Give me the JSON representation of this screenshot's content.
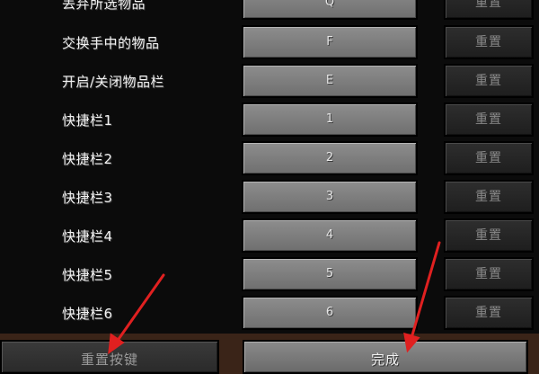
{
  "controls": [
    {
      "label": "丢弃所选物品",
      "key": "Q",
      "reset": "重置"
    },
    {
      "label": "交换手中的物品",
      "key": "F",
      "reset": "重置"
    },
    {
      "label": "开启/关闭物品栏",
      "key": "E",
      "reset": "重置"
    },
    {
      "label": "快捷栏1",
      "key": "1",
      "reset": "重置"
    },
    {
      "label": "快捷栏2",
      "key": "2",
      "reset": "重置"
    },
    {
      "label": "快捷栏3",
      "key": "3",
      "reset": "重置"
    },
    {
      "label": "快捷栏4",
      "key": "4",
      "reset": "重置"
    },
    {
      "label": "快捷栏5",
      "key": "5",
      "reset": "重置"
    },
    {
      "label": "快捷栏6",
      "key": "6",
      "reset": "重置"
    }
  ],
  "footer": {
    "reset_keys_label": "重置按键",
    "done_label": "完成"
  },
  "colors": {
    "annotation_arrow": "#e02020"
  }
}
